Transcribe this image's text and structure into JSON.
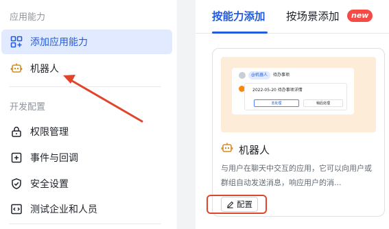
{
  "sidebar": {
    "section1_title": "应用能力",
    "section2_title": "开发配置",
    "items": [
      {
        "label": "添加应用能力",
        "icon": "grid-add-icon"
      },
      {
        "label": "机器人",
        "icon": "robot-icon"
      },
      {
        "label": "权限管理",
        "icon": "lock-icon"
      },
      {
        "label": "事件与回调",
        "icon": "event-plus-icon"
      },
      {
        "label": "安全设置",
        "icon": "shield-check-icon"
      },
      {
        "label": "测试企业和人员",
        "icon": "code-icon"
      }
    ],
    "active_index": 0
  },
  "tabs": {
    "by_ability": "按能力添加",
    "by_scene": "按场景添加",
    "new_badge": "new"
  },
  "card": {
    "preview": {
      "chip": "@机器人",
      "header_text": "待办事项",
      "line_text": "2022-05-20 待办事项详情",
      "button1": "去处理",
      "button2": "稍后处理"
    },
    "icon": "robot-icon",
    "title": "机器人",
    "description": "与用户在聊天中交互的应用，它可以向用户或群组自动发送消息，响应用户的消...",
    "config_label": "配置"
  },
  "colors": {
    "accent": "#245bdb",
    "active_bg": "#e1eaff",
    "annotation": "#e0452b",
    "preview_bg": "#fdecd8",
    "robot": "#d98b1d"
  }
}
